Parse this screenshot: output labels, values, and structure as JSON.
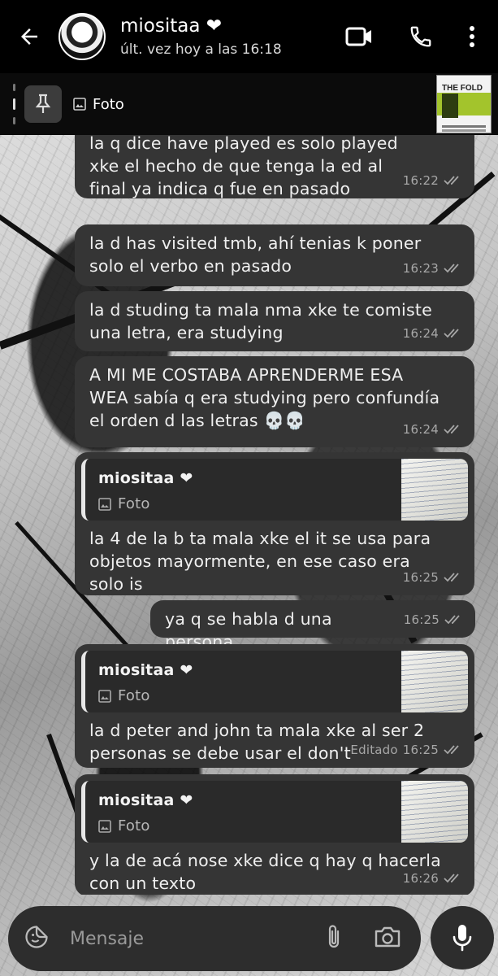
{
  "header": {
    "contact_name": "miositaa ❤",
    "status": "últ. vez hoy a las 16:18"
  },
  "pinned": {
    "label": "Foto",
    "thumb_title": "THE FOLD"
  },
  "messages": [
    {
      "text": "la q dice have played es solo played xke el hecho de que tenga la ed al final ya indica q fue en pasado",
      "time": "16:22"
    },
    {
      "text": "la d has visited tmb, ahí tenias k poner solo el verbo en pasado",
      "time": "16:23"
    },
    {
      "text": "la d studing ta mala nma xke te comiste una letra, era studying",
      "time": "16:24"
    },
    {
      "text": "A MI ME COSTABA APRENDERME ESA WEA sabía q era studying pero confundía el orden d las letras 💀💀",
      "time": "16:24"
    },
    {
      "quote_name": "miositaa ❤",
      "quote_type": "Foto",
      "text": "la 4 de la b ta mala xke el it se usa para objetos mayormente, en ese caso era solo is",
      "time": "16:25"
    },
    {
      "text": "ya q se habla d una persona",
      "time": "16:25"
    },
    {
      "quote_name": "miositaa ❤",
      "quote_type": "Foto",
      "text": "la d peter and john ta mala xke al ser 2 personas se debe usar el don't",
      "edited": "Editado",
      "time": "16:25"
    },
    {
      "quote_name": "miositaa ❤",
      "quote_type": "Foto",
      "text": "y la de acá nose xke dice q hay q hacerla con un texto",
      "time": "16:26"
    }
  ],
  "input": {
    "placeholder": "Mensaje"
  },
  "icons": {
    "back": "arrow-left-icon",
    "video": "video-call-icon",
    "call": "phone-icon",
    "menu": "more-vertical-icon",
    "pin": "pin-icon",
    "photo": "image-icon",
    "sticker": "sticker-icon",
    "attach": "paperclip-icon",
    "camera": "camera-icon",
    "mic": "microphone-icon"
  }
}
